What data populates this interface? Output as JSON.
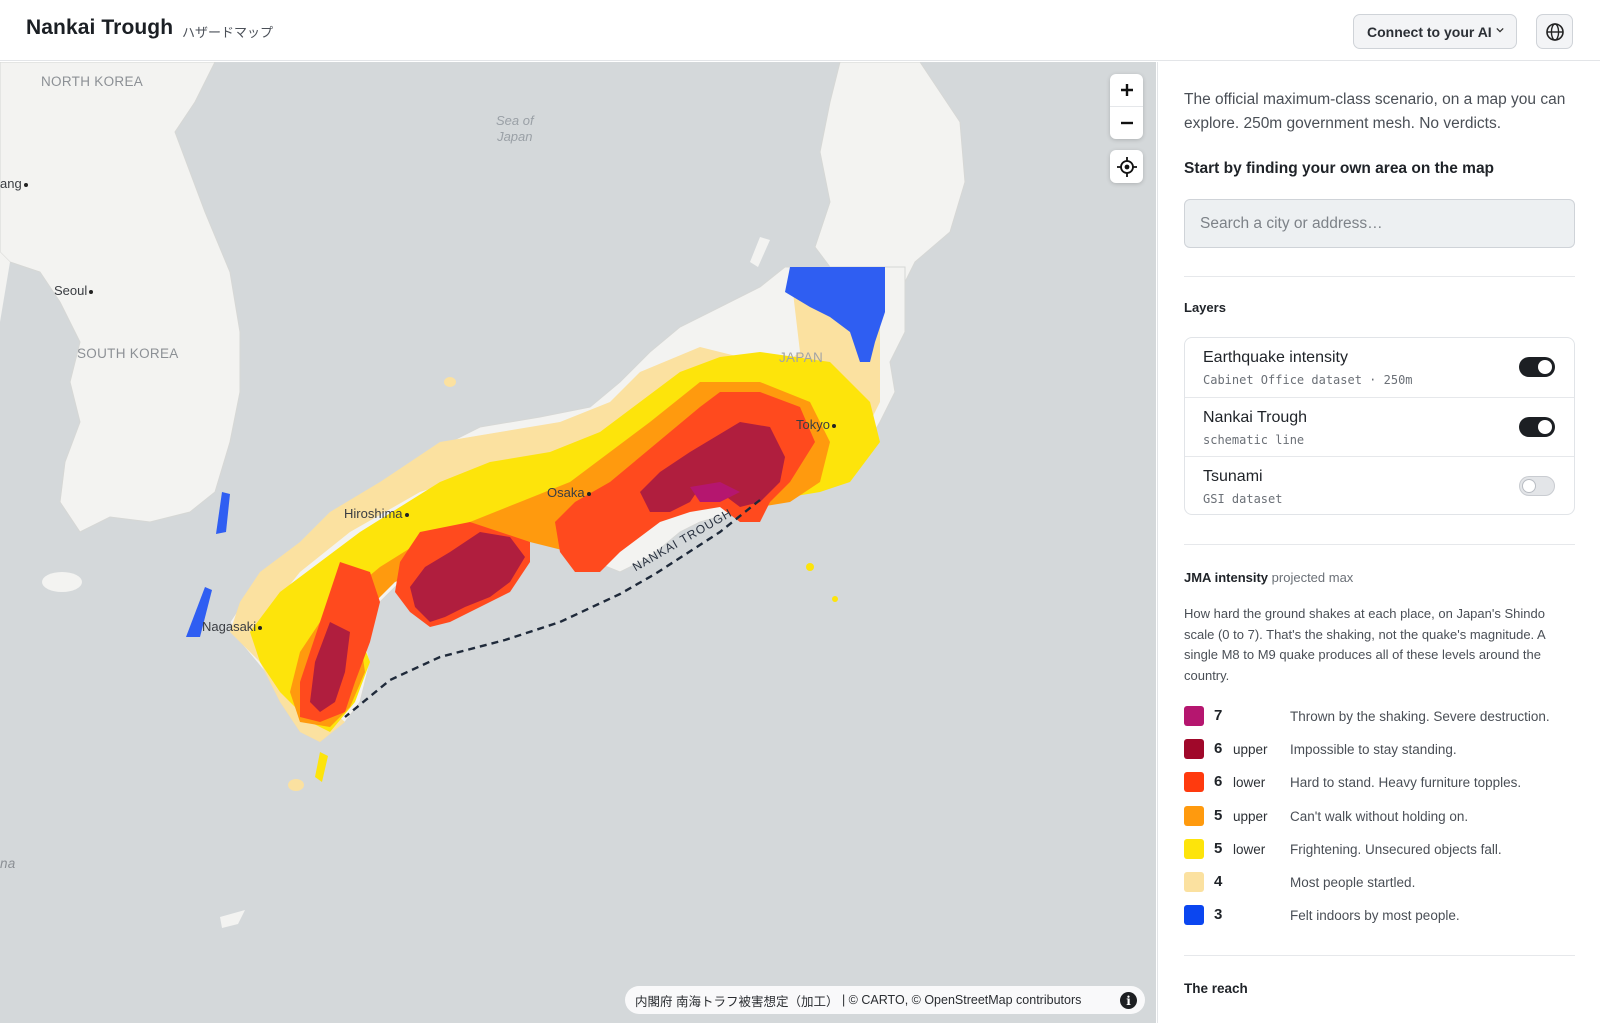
{
  "header": {
    "title": "Nankai Trough",
    "subtitle": "ハザードマップ",
    "connect_label": "Connect to your AI"
  },
  "map": {
    "labels": {
      "north_korea": "NORTH KOREA",
      "south_korea": "SOUTH KOREA",
      "japan": "JAPAN",
      "sea_line1": "Sea of",
      "sea_line2": "Japan",
      "seoul": "Seoul",
      "pyongyang_partial": "ang",
      "hiroshima": "Hiroshima",
      "osaka": "Osaka",
      "tokyo": "Tokyo",
      "nagasaki": "Nagasaki",
      "trough": "NANKAI TROUGH",
      "edge_partial": "na"
    },
    "controls": {
      "zoom_in": "+",
      "zoom_out": "−"
    },
    "attribution": {
      "source": "内閣府 南海トラフ被害想定（加工）",
      "sep": " | © ",
      "carto": "CARTO",
      "sep2": ", © ",
      "osm": "OpenStreetMap",
      "contrib": " contributors",
      "info": "i"
    }
  },
  "panel": {
    "intro": "The official maximum-class scenario, on a map you can explore. 250m government mesh. No verdicts.",
    "start_heading": "Start by finding your own area on the map",
    "search_placeholder": "Search a city or address…",
    "layers_heading": "Layers",
    "layers": [
      {
        "name": "Earthquake intensity",
        "sub": "Cabinet Office dataset · 250m",
        "on": true
      },
      {
        "name": "Nankai Trough",
        "sub": "schematic line",
        "on": true
      },
      {
        "name": "Tsunami",
        "sub": "GSI dataset",
        "on": false
      }
    ],
    "jma_title": "JMA intensity",
    "jma_sub": "projected max",
    "jma_desc": "How hard the ground shakes at each place, on Japan's Shindo scale (0 to 7). That's the shaking, not the quake's magnitude. A single M8 to M9 quake produces all of these levels around the country.",
    "legend": [
      {
        "level": "7",
        "qual": "",
        "desc": "Thrown by the shaking. Severe destruction.",
        "color": "#b5166f"
      },
      {
        "level": "6",
        "qual": "upper",
        "desc": "Impossible to stay standing.",
        "color": "#a0082a"
      },
      {
        "level": "6",
        "qual": "lower",
        "desc": "Hard to stand. Heavy furniture topples.",
        "color": "#ff3a0e"
      },
      {
        "level": "5",
        "qual": "upper",
        "desc": "Can't walk without holding on.",
        "color": "#ff9a0e"
      },
      {
        "level": "5",
        "qual": "lower",
        "desc": "Frightening. Unsecured objects fall.",
        "color": "#fde40b"
      },
      {
        "level": "4",
        "qual": "",
        "desc": "Most people startled.",
        "color": "#fbe1a0"
      },
      {
        "level": "3",
        "qual": "",
        "desc": "Felt indoors by most people.",
        "color": "#0b46f0"
      }
    ],
    "reach_heading": "The reach"
  }
}
